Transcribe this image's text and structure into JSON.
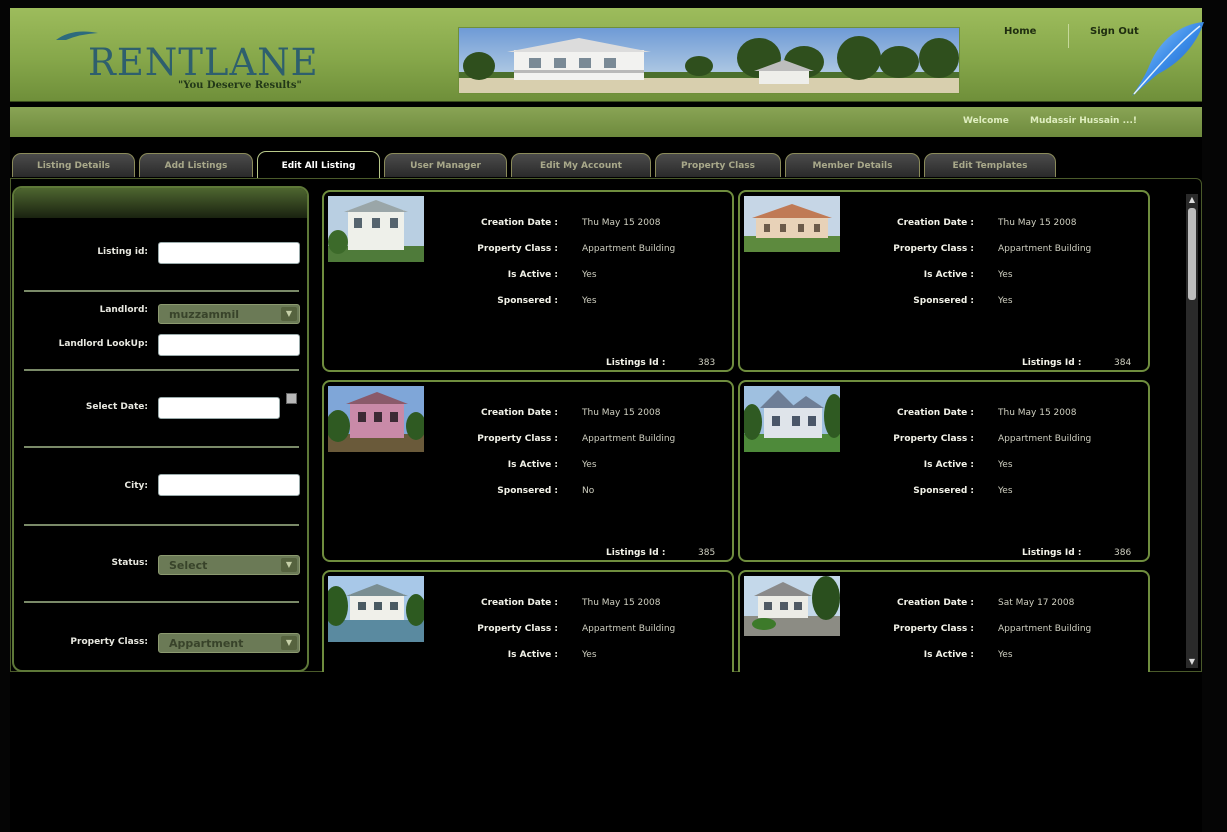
{
  "brand": {
    "name": "RENTLANE",
    "tagline": "\"You Deserve Results\""
  },
  "nav": {
    "home": "Home",
    "sign_out": "Sign Out"
  },
  "welcome": {
    "label": "Welcome",
    "user": "Mudassir Hussain ...!"
  },
  "tabs": [
    "Listing Details",
    "Add Listings",
    "Edit All Listing",
    "User Manager",
    "Edit My Account",
    "Property Class",
    "Member Details",
    "Edit Templates"
  ],
  "active_tab": "Edit All Listing",
  "sidebar": {
    "listing_id": {
      "label": "Listing id:",
      "value": ""
    },
    "landlord": {
      "label": "Landlord:",
      "selected": "muzzammil"
    },
    "landlord_lookup": {
      "label": "Landlord LookUp:",
      "value": ""
    },
    "select_date": {
      "label": "Select Date:",
      "value": ""
    },
    "city": {
      "label": "City:",
      "value": ""
    },
    "status": {
      "label": "Status:",
      "selected": "Select"
    },
    "property_class": {
      "label": "Property Class:",
      "selected": "Appartment"
    }
  },
  "listing_labels": {
    "creation_date": "Creation Date :",
    "property_class": "Property Class :",
    "is_active": "Is Active :",
    "sponsored": "Sponsered :",
    "listings_id": "Listings Id :"
  },
  "listings": [
    {
      "creation_date": "Thu May 15 2008",
      "property_class": "Appartment Building",
      "is_active": "Yes",
      "sponsored": "Yes",
      "id": "383"
    },
    {
      "creation_date": "Thu May 15 2008",
      "property_class": "Appartment Building",
      "is_active": "Yes",
      "sponsored": "Yes",
      "id": "384"
    },
    {
      "creation_date": "Thu May 15 2008",
      "property_class": "Appartment Building",
      "is_active": "Yes",
      "sponsored": "No",
      "id": "385"
    },
    {
      "creation_date": "Thu May 15 2008",
      "property_class": "Appartment Building",
      "is_active": "Yes",
      "sponsored": "Yes",
      "id": "386"
    },
    {
      "creation_date": "Thu May 15 2008",
      "property_class": "Appartment Building",
      "is_active": "Yes"
    },
    {
      "creation_date": "Sat May 17 2008",
      "property_class": "Appartment Building",
      "is_active": "Yes"
    }
  ],
  "colors": {
    "accent_green": "#7d9c45",
    "header_green": "#9dbc5c",
    "background": "#000000"
  },
  "icons": [
    "feather-icon",
    "calendar-icon",
    "dropdown-arrow-icon",
    "scroll-up-icon",
    "scroll-down-icon"
  ]
}
